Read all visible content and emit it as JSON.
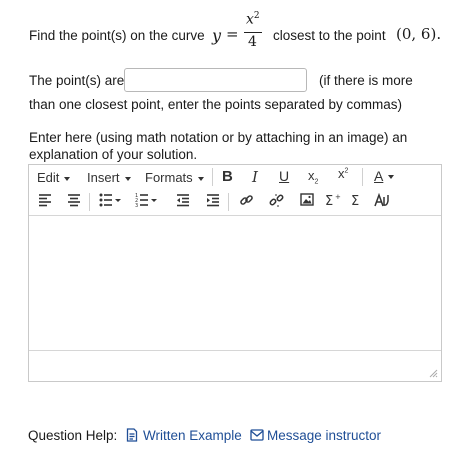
{
  "question": {
    "prefix": "Find the point(s) on the curve",
    "eq_lhs": "y",
    "eq_sign": "=",
    "numerator_base": "x",
    "numerator_exp": "2",
    "denominator": "4",
    "middle": "closest to the point",
    "point": "(0, 6)."
  },
  "answer": {
    "label": "The point(s) are",
    "hint_line1": "(if there is more",
    "hint_line2": "than one closest point, enter the points separated by commas)",
    "value": ""
  },
  "explanation": {
    "line1": "Enter here (using math notation or by attaching in an image) an",
    "line2": "explanation of your solution."
  },
  "editor": {
    "menu": {
      "edit": "Edit",
      "insert": "Insert",
      "formats": "Formats"
    },
    "format_buttons": {
      "bold": "B",
      "italic": "I",
      "underline": "U",
      "subscript_base": "x",
      "subscript_mark": "2",
      "superscript_base": "x",
      "superscript_mark": "2",
      "text_color": "A"
    },
    "colors": {
      "icon": "#333333",
      "border": "#c9c9c9"
    }
  },
  "help": {
    "label": "Question Help:",
    "written_example": "Written Example",
    "message_instructor": "Message instructor",
    "link_color": "#1f4e96"
  }
}
